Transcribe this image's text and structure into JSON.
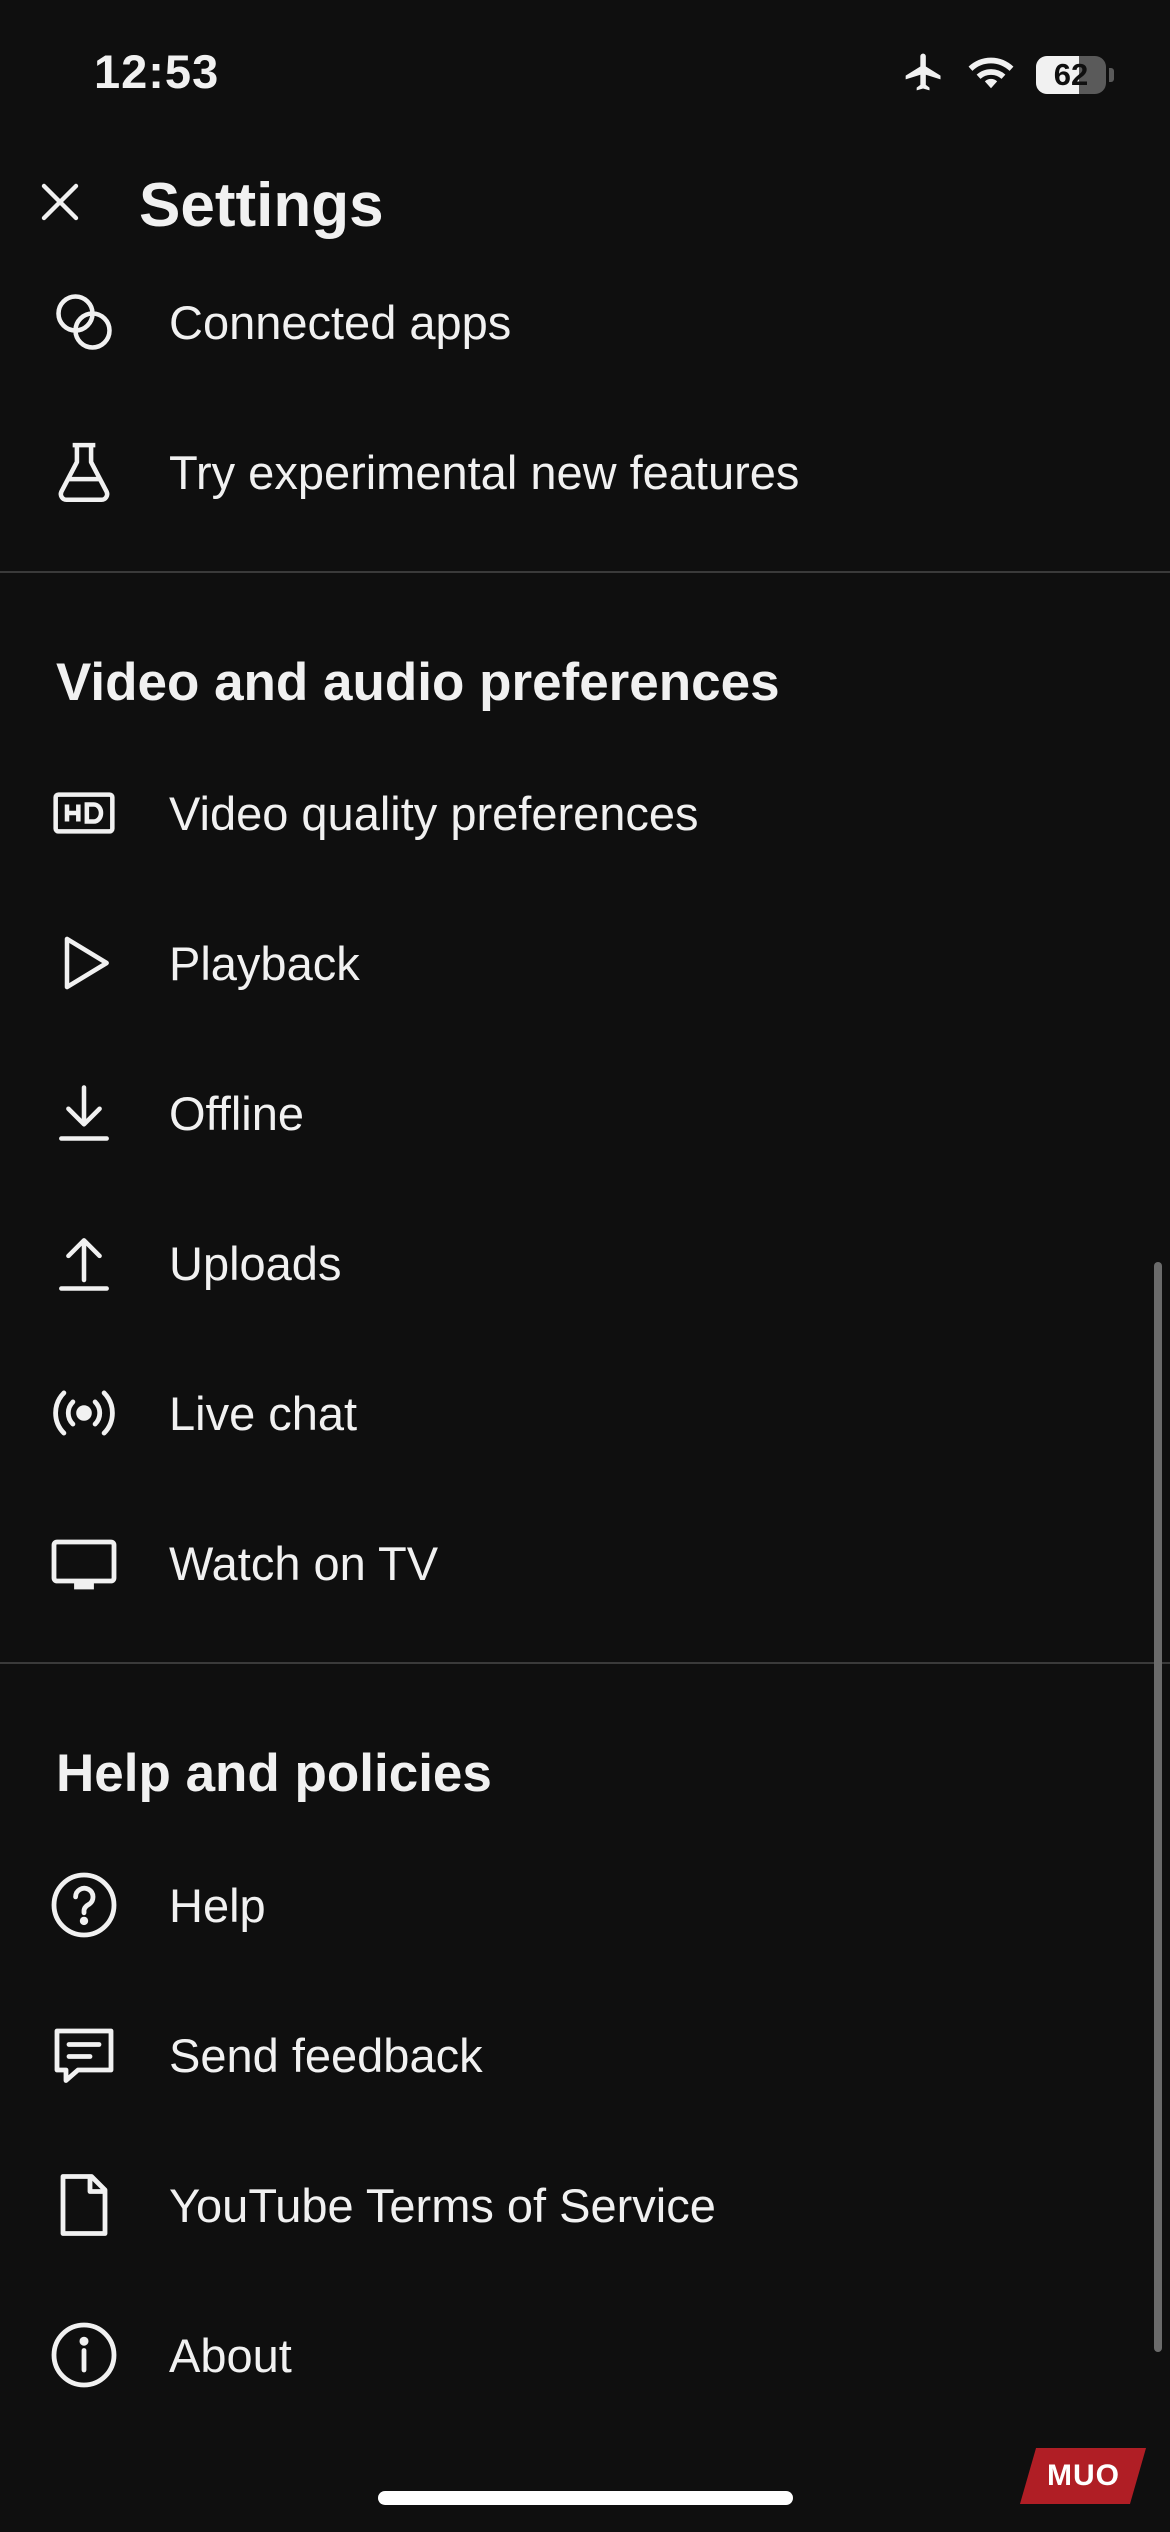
{
  "status_bar": {
    "time": "12:53",
    "battery_level": "62",
    "battery_fraction": 0.62
  },
  "header": {
    "title": "Settings"
  },
  "top_items": [
    {
      "label": "Connected apps",
      "icon": "connected-apps-icon"
    },
    {
      "label": "Try experimental new features",
      "icon": "flask-icon"
    }
  ],
  "video_section": {
    "title": "Video and audio preferences",
    "items": [
      {
        "label": "Video quality preferences",
        "icon": "hd-icon"
      },
      {
        "label": "Playback",
        "icon": "play-icon"
      },
      {
        "label": "Offline",
        "icon": "download-icon"
      },
      {
        "label": "Uploads",
        "icon": "upload-icon"
      },
      {
        "label": "Live chat",
        "icon": "live-icon"
      },
      {
        "label": "Watch on TV",
        "icon": "tv-icon"
      }
    ]
  },
  "help_section": {
    "title": "Help and policies",
    "items": [
      {
        "label": "Help",
        "icon": "help-icon"
      },
      {
        "label": "Send feedback",
        "icon": "feedback-icon"
      },
      {
        "label": "YouTube Terms of Service",
        "icon": "document-icon"
      },
      {
        "label": "About",
        "icon": "info-icon"
      }
    ]
  },
  "watermark": {
    "text": "MUO",
    "color": "#b01e25"
  },
  "colors": {
    "background": "#0f0f0f",
    "text": "#f1f1f1",
    "divider": "#3a3a3a"
  }
}
